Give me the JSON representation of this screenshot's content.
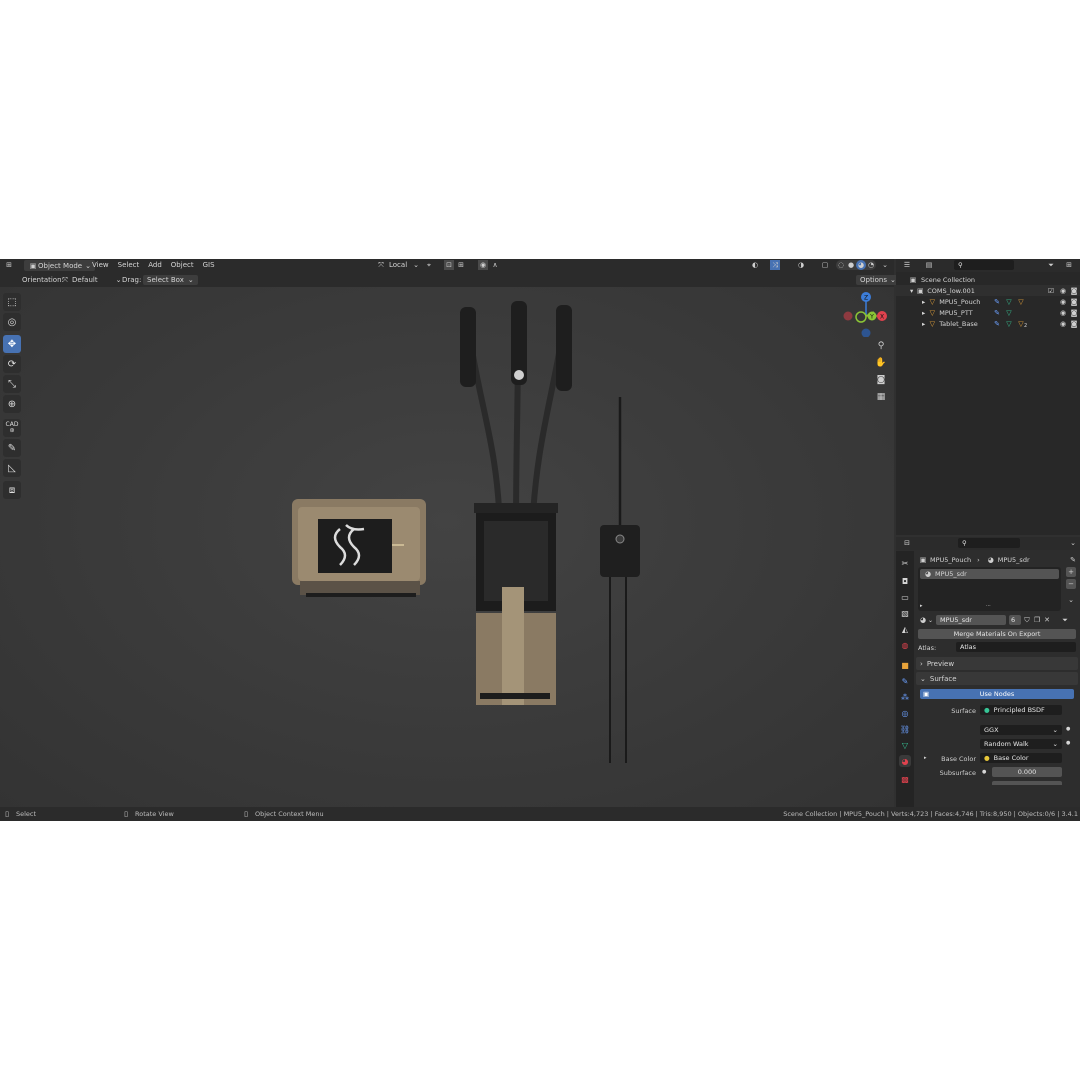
{
  "header": {
    "mode": "Object Mode",
    "menu": [
      "View",
      "Select",
      "Add",
      "Object",
      "GIS"
    ],
    "transform_space": "Local",
    "orientation_label": "Orientation:",
    "orientation_value": "Default",
    "drag_label": "Drag:",
    "drag_value": "Select Box",
    "options": "Options"
  },
  "gizmo": {
    "z": "Z",
    "y": "Y",
    "x": "X"
  },
  "toolbar": {
    "cad_label": "CAD"
  },
  "outliner": {
    "root": "Scene Collection",
    "collection": "COMS_low.001",
    "objects": [
      {
        "name": "MPU5_Pouch"
      },
      {
        "name": "MPU5_PTT"
      },
      {
        "name": "Tablet_Base",
        "badge": "2"
      }
    ]
  },
  "properties": {
    "breadcrumb_object": "MPU5_Pouch",
    "breadcrumb_material": "MPU5_sdr",
    "slot_name": "MPU5_sdr",
    "material_name": "MPU5_sdr",
    "user_count": "6",
    "merge_button": "Merge Materials On Export",
    "atlas_label": "Atlas:",
    "atlas_value": "Atlas",
    "preview_panel": "Preview",
    "surface_panel": "Surface",
    "use_nodes": "Use Nodes",
    "surface_label": "Surface",
    "surface_value": "Principled BSDF",
    "distribution": "GGX",
    "subsurface_method": "Random Walk",
    "base_color_label": "Base Color",
    "base_color_value": "Base Color",
    "subsurface_label": "Subsurface",
    "subsurface_value": "0.000"
  },
  "statusbar": {
    "select": "Select",
    "rotate": "Rotate View",
    "context": "Object Context Menu",
    "stats": "Scene Collection | MPU5_Pouch | Verts:4,723 | Faces:4,746 | Tris:8,950 | Objects:0/6 | 3.4.1"
  },
  "colors": {
    "accent": "#4772b3",
    "axis_x": "#e0424e",
    "axis_y": "#8bc536",
    "axis_z": "#3c7dd9",
    "object_orange": "#e8a33a"
  }
}
